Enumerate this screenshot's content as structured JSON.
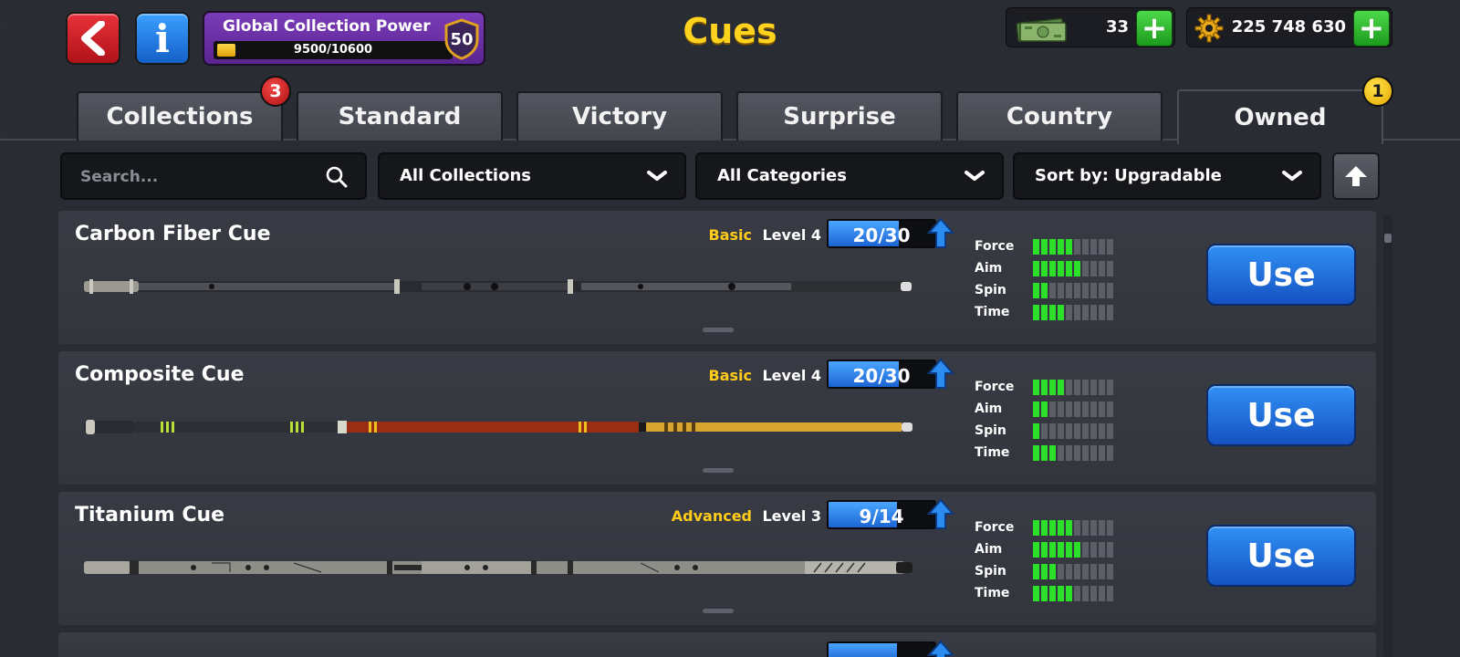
{
  "header": {
    "title": "Cues",
    "collection_power": {
      "label": "Global Collection Power",
      "progress_text": "9500/10600",
      "current": 9500,
      "max": 10600,
      "level": "50"
    },
    "cash": {
      "amount": "33",
      "icon": "cash-icon"
    },
    "coins": {
      "amount": "225 748 630",
      "icon": "gear-coin-icon"
    }
  },
  "tabs": [
    {
      "label": "Collections",
      "badge": "3",
      "active": false
    },
    {
      "label": "Standard",
      "active": false
    },
    {
      "label": "Victory",
      "active": false
    },
    {
      "label": "Surprise",
      "active": false
    },
    {
      "label": "Country",
      "active": false
    },
    {
      "label": "Owned",
      "badge": "1",
      "active": true
    }
  ],
  "filters": {
    "search_placeholder": "Search...",
    "collections": "All Collections",
    "categories": "All Categories",
    "sort": "Sort by: Upgradable"
  },
  "stat_labels": [
    "Force",
    "Aim",
    "Spin",
    "Time"
  ],
  "cues": [
    {
      "name": "Carbon Fiber Cue",
      "rarity": "Basic",
      "level": "Level 4",
      "progress_text": "20/30",
      "progress": 0.667,
      "stats": {
        "Force": 5,
        "Aim": 6,
        "Spin": 2,
        "Time": 4
      },
      "use_label": "Use"
    },
    {
      "name": "Composite Cue",
      "rarity": "Basic",
      "level": "Level 4",
      "progress_text": "20/30",
      "progress": 0.667,
      "stats": {
        "Force": 4,
        "Aim": 2,
        "Spin": 1,
        "Time": 3
      },
      "use_label": "Use"
    },
    {
      "name": "Titanium Cue",
      "rarity": "Advanced",
      "level": "Level 3",
      "progress_text": "9/14",
      "progress": 0.643,
      "stats": {
        "Force": 5,
        "Aim": 6,
        "Spin": 3,
        "Time": 5
      },
      "use_label": "Use"
    }
  ],
  "colors": {
    "accent_gold": "#ffd21e",
    "rarity": "#ffcc1a",
    "use_button": "#1f6fe0",
    "stat_on": "#2ce02a",
    "stat_off": "#5c5f68"
  }
}
